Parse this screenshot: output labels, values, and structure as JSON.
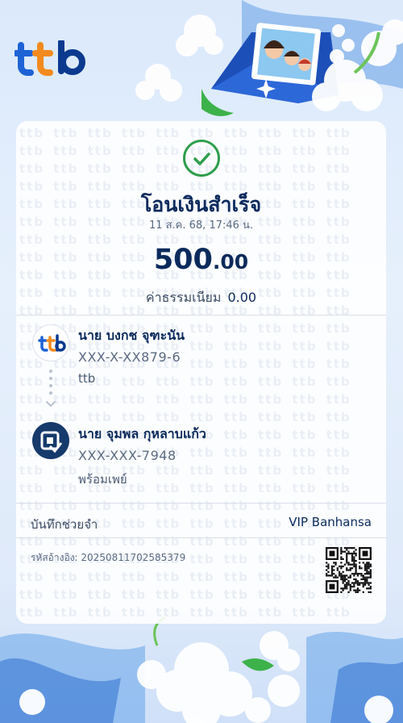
{
  "brand": {
    "logo_text": "ttb"
  },
  "receipt": {
    "title": "โอนเงินสำเร็จ",
    "datetime": "11 ส.ค. 68, 17:46 น.",
    "amount_main": "500",
    "amount_decimal": ".00",
    "fee_label": "ค่าธรรมเนียม",
    "fee_value": "0.00"
  },
  "sender": {
    "name": "นาย บงกช จุฑะนัน",
    "account": "XXX-X-XX879-6",
    "bank": "ttb"
  },
  "receiver": {
    "name": "นาย จุมพล กุหลาบแก้ว",
    "account": "XXX-XXX-7948",
    "bank": "พร้อมเพย์"
  },
  "memo": {
    "label": "บันทึกช่วยจำ",
    "value": "VIP Banhansa"
  },
  "reference": {
    "text": "รหัสอ้างอิง: 20250811702585379"
  },
  "colors": {
    "navy": "#0b2a5c",
    "ttb_blue": "#1e63d6",
    "ttb_orange": "#f28a1d",
    "success_green": "#2f9e4d",
    "background": "#dbe9fb"
  }
}
